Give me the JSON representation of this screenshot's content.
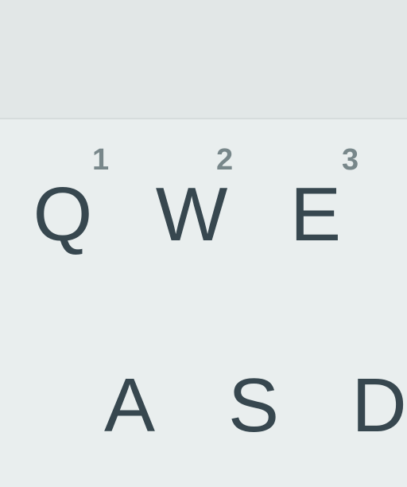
{
  "keyboard": {
    "row1": [
      {
        "letter": "Q",
        "hint": "1"
      },
      {
        "letter": "W",
        "hint": "2"
      },
      {
        "letter": "E",
        "hint": "3"
      }
    ],
    "row2": [
      {
        "letter": "A"
      },
      {
        "letter": "S"
      },
      {
        "letter": "D"
      }
    ]
  }
}
